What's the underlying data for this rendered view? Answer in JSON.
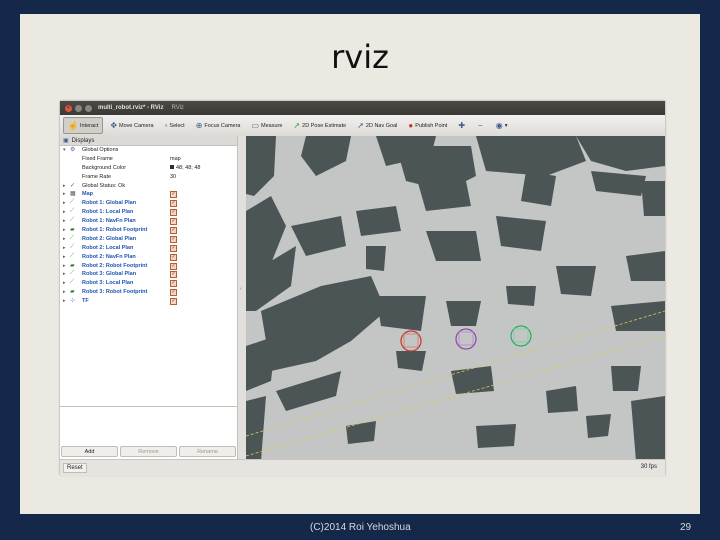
{
  "slide": {
    "title": "rviz",
    "footer_left": "(C)2014 Roi Yehoshua",
    "page_number": "29"
  },
  "window": {
    "title": "multi_robot.rviz* - RViz",
    "app": "RViz"
  },
  "toolbar": [
    {
      "label": "Interact",
      "icon": "hand-icon",
      "active": true
    },
    {
      "label": "Move Camera",
      "icon": "move-camera-icon"
    },
    {
      "label": "Select",
      "icon": "select-icon"
    },
    {
      "label": "Focus Camera",
      "icon": "focus-camera-icon"
    },
    {
      "label": "Measure",
      "icon": "measure-icon"
    },
    {
      "label": "2D Pose Estimate",
      "icon": "pose-estimate-arrow-icon"
    },
    {
      "label": "2D Nav Goal",
      "icon": "nav-goal-arrow-icon"
    },
    {
      "label": "Publish Point",
      "icon": "publish-point-icon"
    }
  ],
  "displays": {
    "header": "Displays",
    "global_options_label": "Global Options",
    "fixed_frame_label": "Fixed Frame",
    "fixed_frame_value": "map",
    "background_color_label": "Background Color",
    "background_color_value": "48; 48; 48",
    "frame_rate_label": "Frame Rate",
    "frame_rate_value": "30",
    "global_status_label": "Global Status: Ok",
    "items": [
      {
        "label": "Map",
        "icon": "map-icon"
      },
      {
        "label": "Robot 1: Global Plan",
        "icon": "path-icon"
      },
      {
        "label": "Robot 1: Local Plan",
        "icon": "path-icon"
      },
      {
        "label": "Robot 1: NavFn Plan",
        "icon": "path-icon"
      },
      {
        "label": "Robot 1: Robot Footprint",
        "icon": "polygon-icon"
      },
      {
        "label": "Robot 2: Global Plan",
        "icon": "path-icon"
      },
      {
        "label": "Robot 2: Local Plan",
        "icon": "path-icon"
      },
      {
        "label": "Robot 2: NavFn Plan",
        "icon": "path-icon"
      },
      {
        "label": "Robot 2: Robot Footprint",
        "icon": "polygon-icon"
      },
      {
        "label": "Robot 3: Global Plan",
        "icon": "path-icon"
      },
      {
        "label": "Robot 3: Local Plan",
        "icon": "path-icon"
      },
      {
        "label": "Robot 3: Robot Footprint",
        "icon": "polygon-icon"
      },
      {
        "label": "TF",
        "icon": "tf-icon"
      }
    ],
    "buttons": {
      "add": "Add",
      "remove": "Remove",
      "rename": "Rename"
    }
  },
  "statusbar": {
    "reset": "Reset",
    "fps": "30 fps"
  },
  "colors": {
    "background_page": "#14284a",
    "map_free": "#c3c6c4",
    "map_obstacle": "#4b5556",
    "robot_1": "#c0392b",
    "robot_2": "#8e44ad",
    "robot_3": "#27ae60"
  }
}
